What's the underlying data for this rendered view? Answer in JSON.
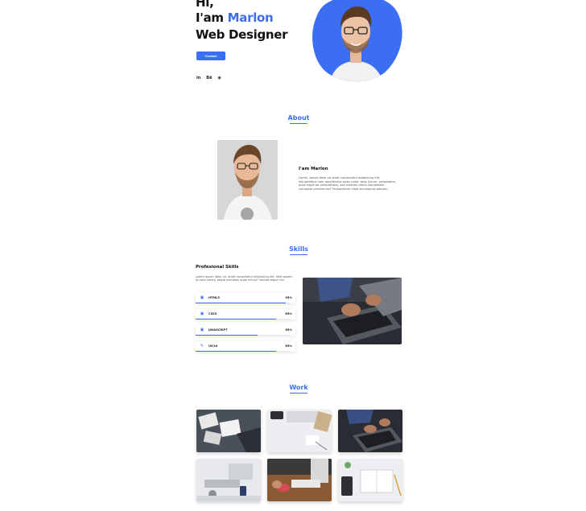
{
  "hero": {
    "greeting": "Hi,",
    "iam": "I'am ",
    "name": "Marlon",
    "role": "Web Designer",
    "contact_label": "Contact",
    "social": [
      {
        "label": "in",
        "icon": "linkedin-icon"
      },
      {
        "label": "Bē",
        "icon": "behance-icon"
      },
      {
        "label": "◉",
        "icon": "github-icon"
      }
    ]
  },
  "about": {
    "title": "About",
    "name": "I'am Marlon",
    "text": "Lorem, ipsum dolor sit amet consectetur adipisicing elit. Voluptatibus nam repellendus quas culpa. Ipsa, ipsum, voluptatem, quos hagiit ab voluptatibus, sed maxime nemo voluptatem voluptate perferendis? Praesentium vitae accusamus adipisci."
  },
  "skills": {
    "title": "Skills",
    "heading": "Profesional Skills",
    "text": "Lorem ipsum dolor sit, amet consectetur adipisicing elit. Velit sapien to nora ameid, atque necubtos quae minus? nesciat atque nisi.",
    "items": [
      {
        "name": "HTML5",
        "percent": "95%",
        "value": 0.95,
        "icon": "html5-icon"
      },
      {
        "name": "CSS3",
        "percent": "85%",
        "value": 0.85,
        "icon": "css3-icon"
      },
      {
        "name": "JAVASCRIPT",
        "percent": "65%",
        "value": 0.65,
        "icon": "javascript-icon"
      },
      {
        "name": "UX/UI",
        "percent": "85%",
        "value": 0.85,
        "icon": "pencil-icon"
      }
    ]
  },
  "work": {
    "title": "Work"
  },
  "colors": {
    "accent": "#3b6ef0",
    "text": "#111111"
  }
}
